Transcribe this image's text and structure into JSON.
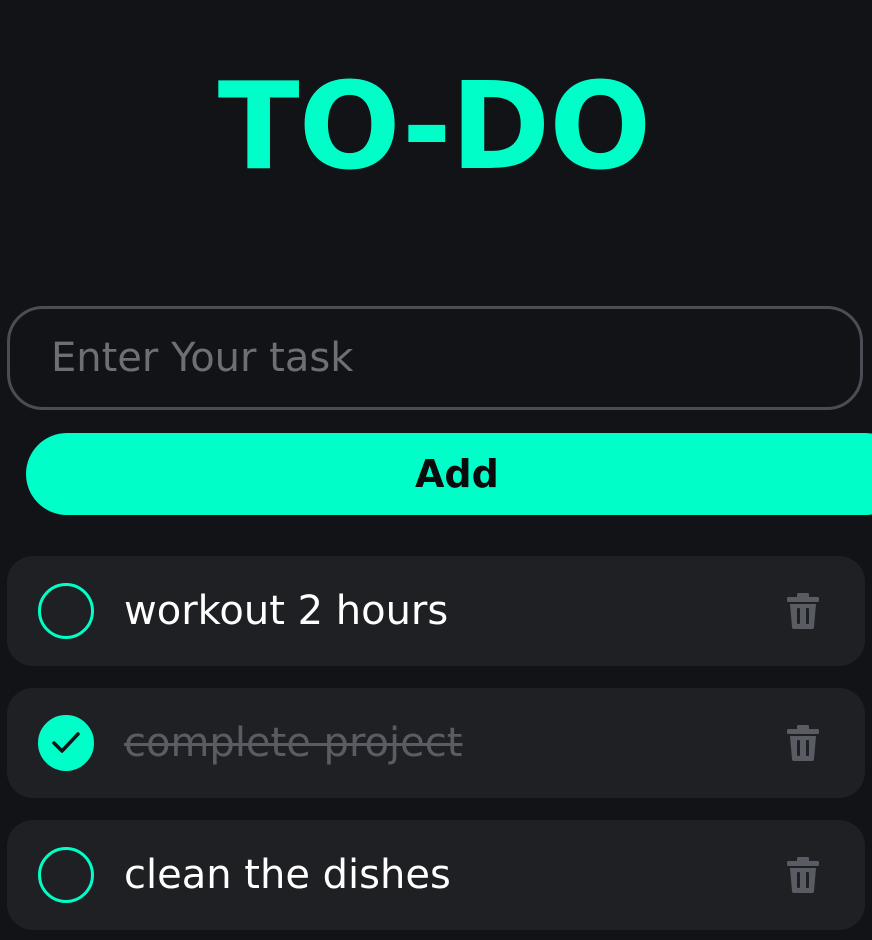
{
  "app": {
    "title": "TO-DO"
  },
  "input": {
    "placeholder": "Enter Your task",
    "value": ""
  },
  "add_button": {
    "label": "Add"
  },
  "tasks": [
    {
      "text": "workout 2 hours",
      "completed": false
    },
    {
      "text": "complete project",
      "completed": true
    },
    {
      "text": "clean the dishes",
      "completed": false
    }
  ],
  "icons": {
    "check": "check-icon",
    "delete": "trash-icon"
  },
  "colors": {
    "accent": "#00ffc8",
    "background": "#121317",
    "card": "#1f2024",
    "muted": "#5a5c63",
    "trash": "#5a5c63"
  }
}
